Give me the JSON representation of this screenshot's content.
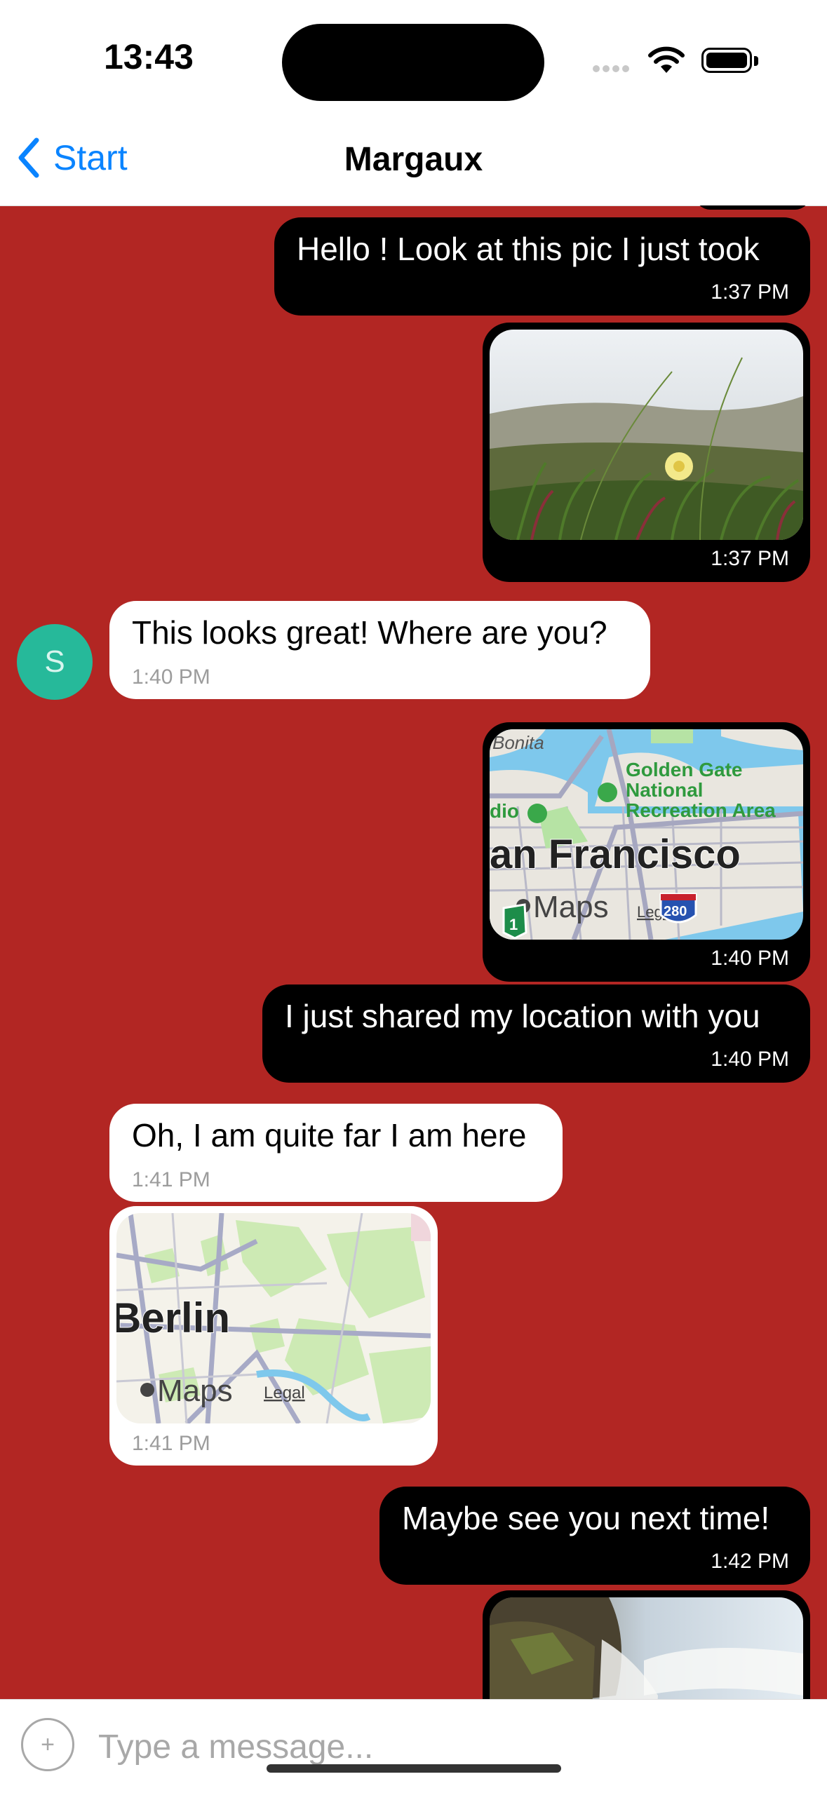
{
  "status": {
    "time": "13:43"
  },
  "nav": {
    "back_label": "Start",
    "title": "Margaux"
  },
  "contact": {
    "initial": "S"
  },
  "messages": [
    {
      "text": "Hello ! Look at this pic I just took",
      "time": "1:37 PM"
    },
    {
      "time": "1:37 PM"
    },
    {
      "text": "This looks great! Where are you?",
      "time": "1:40 PM"
    },
    {
      "map_labels": [
        "Bonita",
        "Golden Gate",
        "National",
        "Recreation Area",
        "dio",
        "an Francisco",
        "Maps",
        "Legal",
        "1",
        "280"
      ],
      "time": "1:40 PM"
    },
    {
      "text": "I just shared my location with you",
      "time": "1:40 PM"
    },
    {
      "text": "Oh, I am quite far I am here",
      "time": "1:41 PM"
    },
    {
      "map_labels": [
        "Berlin",
        "Maps",
        "Legal"
      ],
      "time": "1:41 PM"
    },
    {
      "text": "Maybe see you next time!",
      "time": "1:42 PM"
    }
  ],
  "composer": {
    "placeholder": "Type a message..."
  },
  "colors": {
    "chat_background": "#b22623",
    "outgoing_bubble": "#000000",
    "incoming_bubble": "#ffffff",
    "accent": "#0a84ff",
    "avatar": "#26b99a"
  }
}
